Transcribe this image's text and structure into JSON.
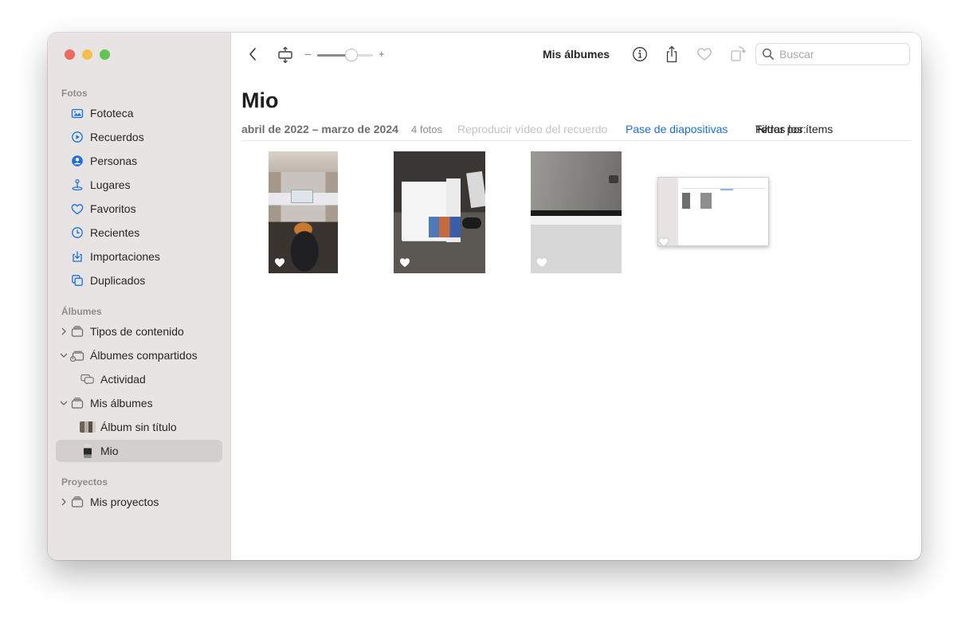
{
  "window": {
    "traffic_lights": [
      "#ed6a5e",
      "#f5bf4f",
      "#61c554"
    ]
  },
  "sidebar": {
    "sections": {
      "fotos": "Fotos",
      "albumes": "Álbumes",
      "proyectos": "Proyectos"
    },
    "fotos_items": [
      {
        "label": "Fototeca",
        "icon": "photo-library-icon"
      },
      {
        "label": "Recuerdos",
        "icon": "memories-icon"
      },
      {
        "label": "Personas",
        "icon": "people-icon"
      },
      {
        "label": "Lugares",
        "icon": "places-icon"
      },
      {
        "label": "Favoritos",
        "icon": "heart-icon"
      },
      {
        "label": "Recientes",
        "icon": "clock-icon"
      },
      {
        "label": "Importaciones",
        "icon": "import-icon"
      },
      {
        "label": "Duplicados",
        "icon": "duplicates-icon"
      }
    ],
    "album_items": [
      {
        "label": "Tipos de contenido",
        "icon": "folder-stack-icon",
        "expanded": false
      },
      {
        "label": "Álbumes compartidos",
        "icon": "shared-albums-icon",
        "expanded": true
      },
      {
        "label": "Actividad",
        "icon": "activity-icon"
      },
      {
        "label": "Mis álbumes",
        "icon": "folder-stack-icon",
        "expanded": true
      },
      {
        "label": "Álbum sin título"
      },
      {
        "label": "Mio",
        "selected": true
      }
    ],
    "project_items": [
      {
        "label": "Mis proyectos",
        "icon": "folder-stack-icon",
        "expanded": false
      }
    ]
  },
  "toolbar": {
    "title": "Mis álbumes",
    "zoom_minus": "–",
    "zoom_plus": "+",
    "zoom_level": 0.62,
    "search_placeholder": "Buscar"
  },
  "album": {
    "title": "Mio",
    "date_range": "abril de 2022 – marzo de 2024",
    "count": "4 fotos",
    "play_memory": "Reproducir vídeo del recuerdo",
    "slideshow": "Pase de diapositivas",
    "filter_label": "Filtrar por:",
    "filter_value": "Todos los ítems"
  },
  "colors": {
    "accent": "#1a6fe0",
    "sidebar_bg": "#e7e4e3",
    "selected_bg": "#d3cfce"
  }
}
